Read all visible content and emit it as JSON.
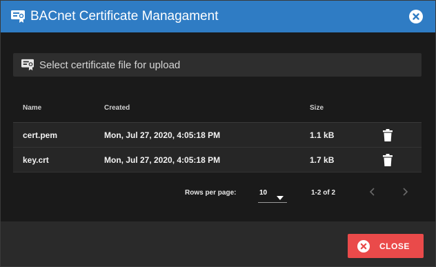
{
  "dialog": {
    "title": "BACnet Certificate Managament",
    "title_icon": "certificate-icon",
    "close_icon": "close-circle-icon"
  },
  "upload": {
    "icon": "certificate-icon",
    "label": "Select certificate file for upload"
  },
  "table": {
    "columns": [
      "Name",
      "Created",
      "Size"
    ],
    "rows": [
      {
        "name": "cert.pem",
        "created": "Mon, Jul 27, 2020, 4:05:18 PM",
        "size": "1.1 kB",
        "action_icon": "trash-icon"
      },
      {
        "name": "key.crt",
        "created": "Mon, Jul 27, 2020, 4:05:18 PM",
        "size": "1.7 kB",
        "action_icon": "trash-icon"
      }
    ]
  },
  "pagination": {
    "rows_per_page_label": "Rows per page:",
    "rows_per_page_value": "10",
    "range": "1-2 of 2",
    "prev_icon": "chevron-left-icon",
    "next_icon": "chevron-right-icon"
  },
  "footer": {
    "close_label": "CLOSE",
    "close_icon": "close-circle-icon"
  },
  "colors": {
    "titlebar": "#2f7cc4",
    "close_button": "#ea4a4a",
    "background": "#1a1a1a"
  }
}
